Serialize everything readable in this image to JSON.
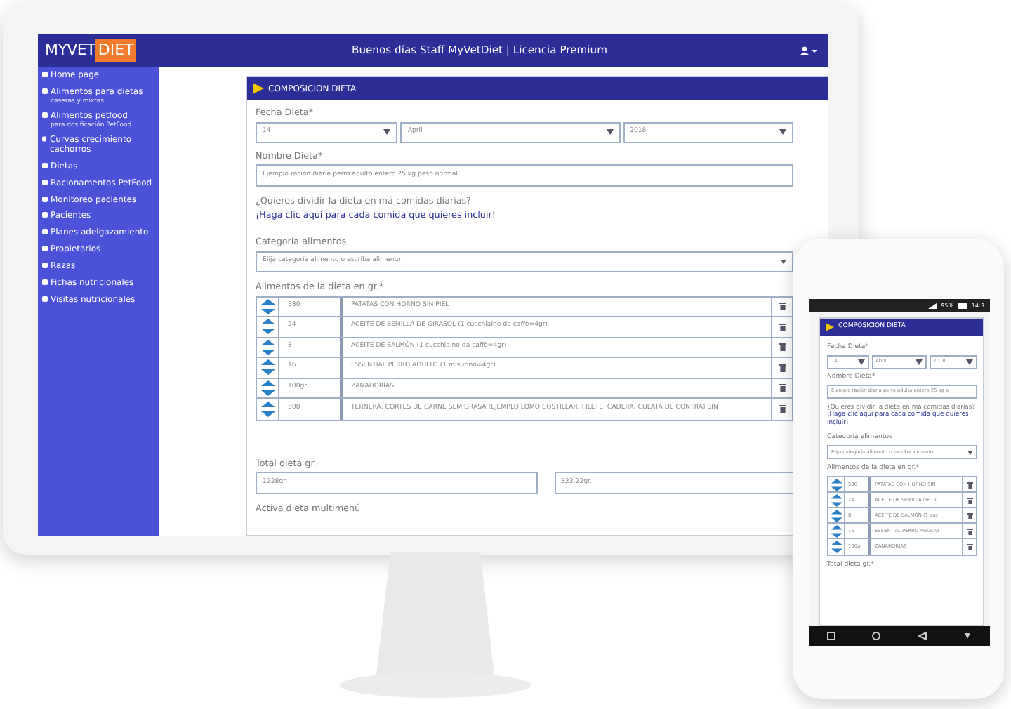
{
  "desktop": {
    "brand": {
      "part_1": "MYVET",
      "part_2": "DIET"
    },
    "greeting": "Buenos días Staff MyVetDiet | Licencia Premium",
    "sidebar": [
      {
        "label": "Home page"
      },
      {
        "label": "Alimentos para dietas",
        "sublabel": "caseras y mixtas"
      },
      {
        "label": "Alimentos petfood",
        "sublabel": "para dosificación PetFood"
      },
      {
        "label": "Curvas crecimiento cachorros"
      },
      {
        "label": "Dietas"
      },
      {
        "label": "Racionamentos PetFood"
      },
      {
        "label": "Monitoreo pacientes"
      },
      {
        "label": "Pacientes"
      },
      {
        "label": "Planes adelgazamiento"
      },
      {
        "label": "Propietarios"
      },
      {
        "label": "Razas"
      },
      {
        "label": "Fichas nutricionales"
      },
      {
        "label": "Visitas nutricionales"
      }
    ],
    "form": {
      "title": "COMPOSICIÓN DIETA",
      "date_label": "Fecha Dieta*",
      "date_selects": [
        "14",
        "April",
        "2018"
      ],
      "name_label": "Nombre Dieta*",
      "name_value": "Ejemplo ración diaria perro adulto entero 25 kg peso normal",
      "question": "¿Quieres dividir la dieta en má comidas diarias?",
      "link": "¡Haga clic aquí para cada comida que quieres incluir!",
      "category_label": "Categoría alimentos",
      "category_placeholder": "Elija categoría alimento o escriba alimento",
      "foods_label": "Alimentos de la dieta en gr.*",
      "foods": [
        {
          "quantity": "580",
          "name": "PATATAS CON HORNO SIN PIEL"
        },
        {
          "quantity": "24",
          "name": "ACEITE DE SEMILLA DE GIRASOL (1 cucchiaino da caffè=4gr)"
        },
        {
          "quantity": "8",
          "name": "ACEITE DE SALMÓN (1 cucchiaino da caffè=4gr)"
        },
        {
          "quantity": "16",
          "name": "ESSENTIAL PERRO ADULTO (1 misurino=4gr)"
        },
        {
          "quantity": "100gr.",
          "name": "ZANAHORIAS"
        },
        {
          "quantity": "500",
          "name": "TERNERA, CORTES DE CARNE SEMIGRASA (EJEMPLO LOMO,COSTILLAR, FILETE, CADERA, CULATA DE CONTRA) SIN"
        }
      ],
      "total_label": "Total dieta gr.",
      "totals": [
        "1228gr.",
        "323.22gr."
      ],
      "multimenu_label": "Activa dieta multimenú"
    }
  },
  "phone": {
    "status_bar": {
      "battery": "95%",
      "time": "14:3"
    },
    "form": {
      "title": "COMPOSICIÓN DIETA",
      "date_label": "Fecha Dieta*",
      "date_selects": [
        "14",
        "Abril",
        "2018"
      ],
      "name_label": "Nombre Dieta*",
      "name_value": "Ejemplo ración diaria perro adulto entero 25 kg p",
      "question": "¿Quieres dividir la dieta en má comidas diarias?",
      "link": "¡Haga clic aquí para cada comida que quieres incluir!",
      "category_label": "Categoría alimentos",
      "category_placeholder": "Elija categoría alimento o escriba alimento",
      "foods_label": "Alimentos de la dieta en gr.*",
      "foods": [
        {
          "quantity": "580",
          "name": "PATATAS CON HORNO SIN"
        },
        {
          "quantity": "24",
          "name": "ACEITE DE SEMILLA DE GI"
        },
        {
          "quantity": "8",
          "name": "ACEITE DE SALMÓN (1 cuc"
        },
        {
          "quantity": "16",
          "name": "ESSENTIAL PERRO ADULTO"
        },
        {
          "quantity": "100gr",
          "name": "ZANAHORIAS"
        }
      ],
      "total_label": "Total dieta gr.*"
    }
  }
}
